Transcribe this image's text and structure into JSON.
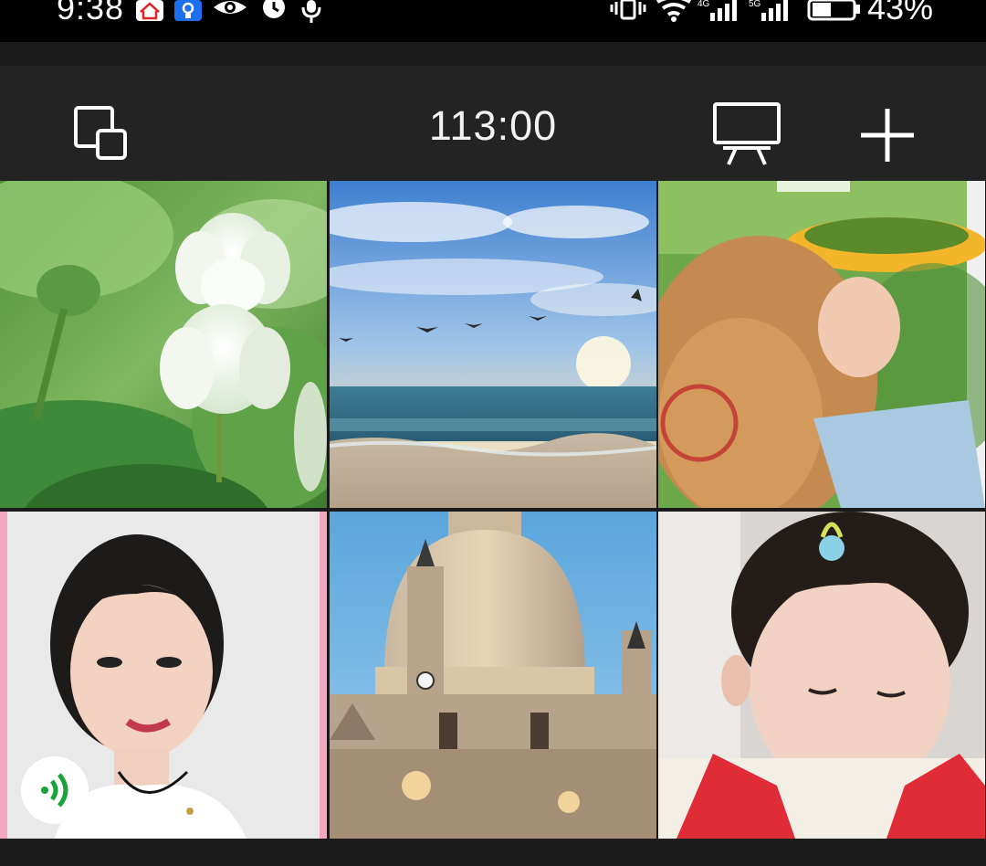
{
  "status_bar": {
    "time": "9:38",
    "battery_percent": "43%",
    "icons": [
      "home-app-icon",
      "bulb-app-icon",
      "eye-icon",
      "alarm-icon",
      "mic-icon",
      "vibrate-icon",
      "wifi-icon",
      "signal-4g-icon",
      "signal-5g-icon",
      "battery-icon"
    ]
  },
  "toolbar": {
    "timer": "113:00",
    "left_icon": "switch-layout-icon",
    "right_icons": [
      "screen-share-icon",
      "add-icon"
    ]
  },
  "grid": {
    "tiles": [
      {
        "name": "tile-white-lotus",
        "kind": "photo"
      },
      {
        "name": "tile-sea-sunset",
        "kind": "photo"
      },
      {
        "name": "tile-girl-sunflower",
        "kind": "photo"
      },
      {
        "name": "tile-woman-portrait",
        "kind": "photo",
        "badge": "speaking-icon"
      },
      {
        "name": "tile-cathedral-dome",
        "kind": "photo"
      },
      {
        "name": "tile-toddler",
        "kind": "photo"
      }
    ]
  },
  "colors": {
    "statusbar_bg": "#000000",
    "toolbar_bg": "#232323",
    "speaking_accent": "#1aa33a"
  }
}
